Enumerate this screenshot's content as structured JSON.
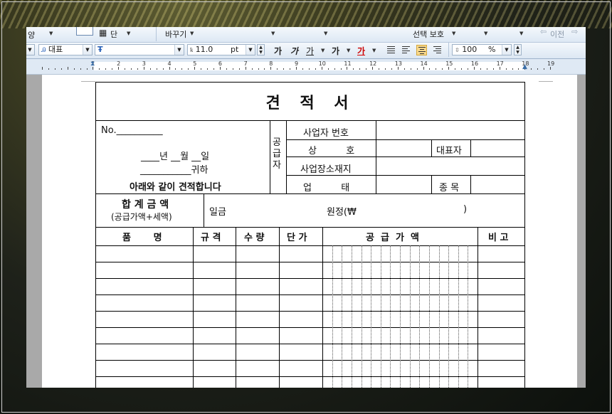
{
  "toolbar_top": {
    "left_fragment": "양",
    "table_label": "단",
    "replace_label": "바꾸기",
    "select_protect_label": "선택 보호",
    "right_label": "이전"
  },
  "toolbar_format": {
    "style_value": "대표",
    "font_value": "",
    "size_value": "11.0",
    "size_unit": "pt",
    "bold_label": "가",
    "italic_label": "가",
    "underline_label": "가",
    "outline_label": "가",
    "color_label": "가",
    "zoom_value": "100",
    "zoom_unit": "%"
  },
  "ruler": {
    "numbers": [
      "1",
      "2",
      "3",
      "4",
      "5",
      "6",
      "7",
      "8",
      "9",
      "10",
      "11",
      "12",
      "13",
      "14",
      "15",
      "16",
      "17",
      "18",
      "19"
    ]
  },
  "document": {
    "title": "견 적 서",
    "no_label": "No.__________",
    "date_line": "____년 __월 __일",
    "recipient_line": "___________귀하",
    "statement": "아래와 같이 견적합니다",
    "supplier_label": "공\n급\n자",
    "supplier_fields": {
      "biz_no": "사업자 번호",
      "company": "상          호",
      "ceo": "대표자",
      "address": "사업장소재지",
      "biz_type": "업          태",
      "category": "종 목"
    },
    "total_label": "합 계 금 액",
    "total_sub": "(공급가액+세액)",
    "total_left": "일금",
    "total_right": "원정(₩",
    "total_close": ")",
    "columns": [
      "품       명",
      "규 격",
      "수 량",
      "단 가",
      "공  급  가  액",
      "비 고"
    ]
  }
}
